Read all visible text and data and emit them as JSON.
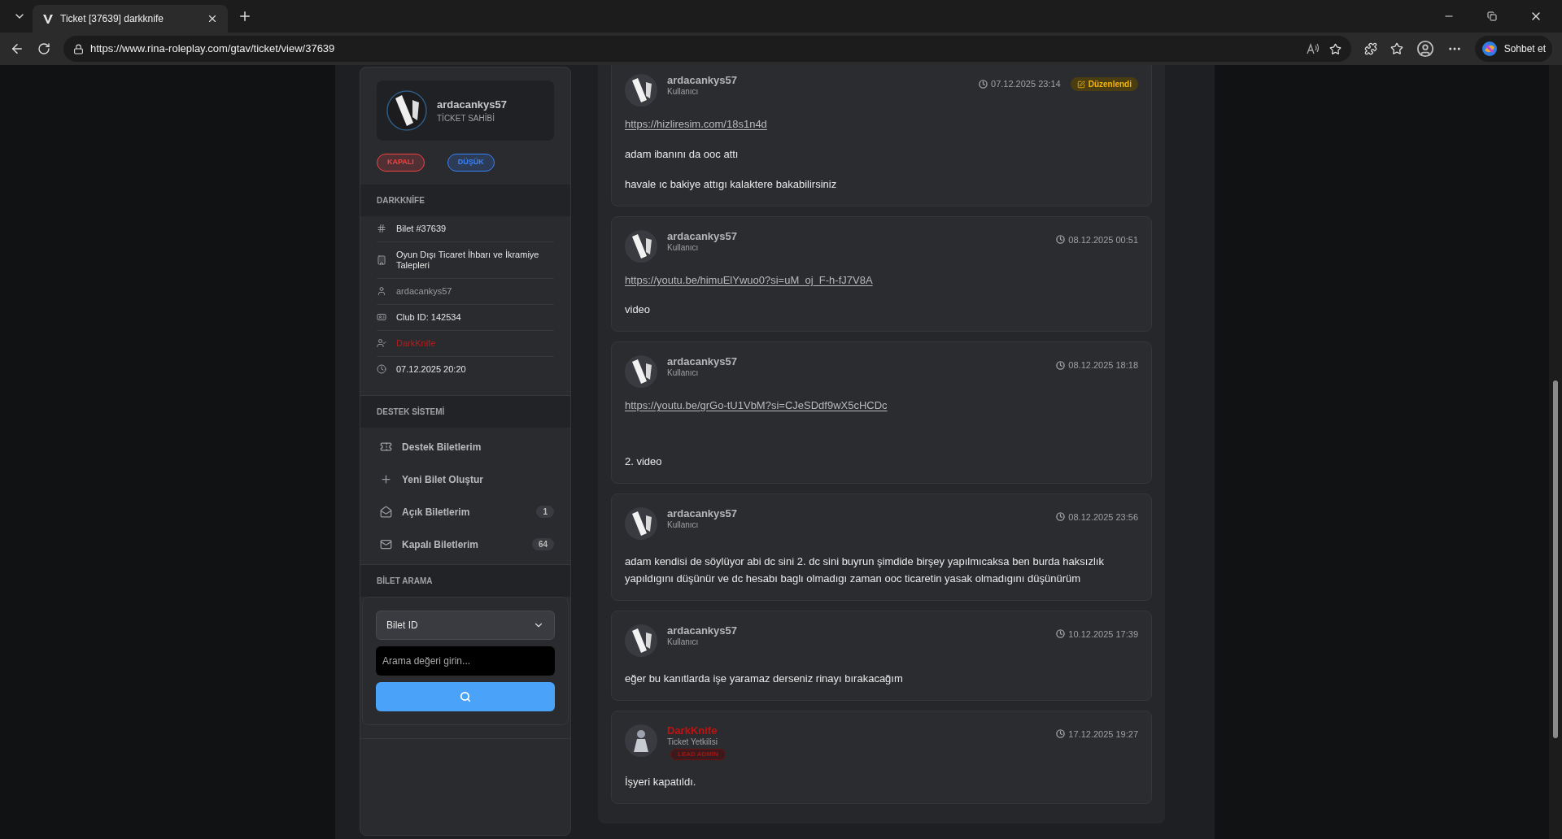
{
  "browser": {
    "tab_title": "Ticket [37639] darkknife",
    "url": "https://www.rina-roleplay.com/gtav/ticket/view/37639",
    "chat_label": "Sohbet et"
  },
  "sidebar": {
    "owner": {
      "name": "ardacankys57",
      "role": "TİCKET SAHİBİ"
    },
    "badges": [
      {
        "label": "KAPALI",
        "color": "#ef4444"
      },
      {
        "label": "DÜŞÜK",
        "color": "#3b82f6"
      }
    ],
    "info_title": "DARKKNİFE",
    "info": [
      {
        "kind": "hash",
        "text": "Bilet #37639",
        "color": "#e6e6e6"
      },
      {
        "kind": "building",
        "text": "Oyun Dışı Ticaret İhbarı ve İkramiye Talepleri",
        "color": "#e6e6e6"
      },
      {
        "kind": "user",
        "text": "ardacankys57",
        "color": "#9a9ba0"
      },
      {
        "kind": "idcard",
        "text": "Club ID: 142534",
        "color": "#e6e6e6"
      },
      {
        "kind": "usercheck",
        "text": "DarkKnife",
        "color": "#b91c1c"
      },
      {
        "kind": "clock",
        "text": "07.12.2025 20:20",
        "color": "#e6e6e6"
      }
    ],
    "nav_title": "DESTEK SİSTEMİ",
    "nav": [
      {
        "kind": "ticket",
        "label": "Destek Biletlerim"
      },
      {
        "kind": "plus",
        "label": "Yeni Bilet Oluştur"
      },
      {
        "kind": "open",
        "label": "Açık Biletlerim",
        "count": "1"
      },
      {
        "kind": "mail",
        "label": "Kapalı Biletlerim",
        "count": "64"
      }
    ],
    "search_title": "BİLET ARAMA",
    "search": {
      "select": "Bilet ID",
      "placeholder": "Arama değeri girin..."
    }
  },
  "messages": [
    {
      "kind": "logo",
      "staff": false,
      "author": "ardacankys57",
      "role": "Kullanıcı",
      "time": "07.12.2025 23:14",
      "edited": "Düzenlendi",
      "body": [
        {
          "kind": "link",
          "text": "https://hizliresim.com/18s1n4d"
        },
        {
          "kind": "text",
          "text": "adam ibanını da ooc attı"
        },
        {
          "kind": "text",
          "text": "havale ıc bakiye attıgı kalaktere bakabilirsiniz"
        }
      ]
    },
    {
      "kind": "logo",
      "staff": false,
      "author": "ardacankys57",
      "role": "Kullanıcı",
      "time": "08.12.2025 00:51",
      "body": [
        {
          "kind": "link",
          "text": "https://youtu.be/himuElYwuo0?si=uM_oj_F-h-fJ7V8A"
        },
        {
          "kind": "text",
          "text": "video"
        }
      ]
    },
    {
      "kind": "logo",
      "staff": false,
      "author": "ardacankys57",
      "role": "Kullanıcı",
      "time": "08.12.2025 18:18",
      "body": [
        {
          "kind": "link",
          "text": "https://youtu.be/grGo-tU1VbM?si=CJeSDdf9wX5cHCDc"
        },
        {
          "kind": "gap"
        },
        {
          "kind": "text",
          "text": "2. video"
        }
      ]
    },
    {
      "kind": "logo",
      "staff": false,
      "author": "ardacankys57",
      "role": "Kullanıcı",
      "time": "08.12.2025 23:56",
      "body": [
        {
          "kind": "text",
          "text": "adam kendisi de söylüyor abi dc sini 2. dc sini buyrun şimdide birşey yapılmıcaksa ben burda haksızlık yapıldıgını düşünür ve dc hesabı baglı olmadıgı zaman ooc ticaretin yasak olmadıgını düşünürüm"
        }
      ]
    },
    {
      "kind": "logo",
      "staff": false,
      "author": "ardacankys57",
      "role": "Kullanıcı",
      "time": "10.12.2025 17:39",
      "body": [
        {
          "kind": "text",
          "text": "eğer bu kanıtlarda işe yaramaz derseniz rinayı bırakacağım"
        }
      ]
    },
    {
      "kind": "figure",
      "author": "DarkKnife",
      "staff": true,
      "role": "Ticket Yetkilisi",
      "rank": "LEAD ADMİN",
      "time": "17.12.2025 19:27",
      "body": [
        {
          "kind": "text",
          "text": "İşyeri kapatıldı."
        }
      ]
    }
  ]
}
